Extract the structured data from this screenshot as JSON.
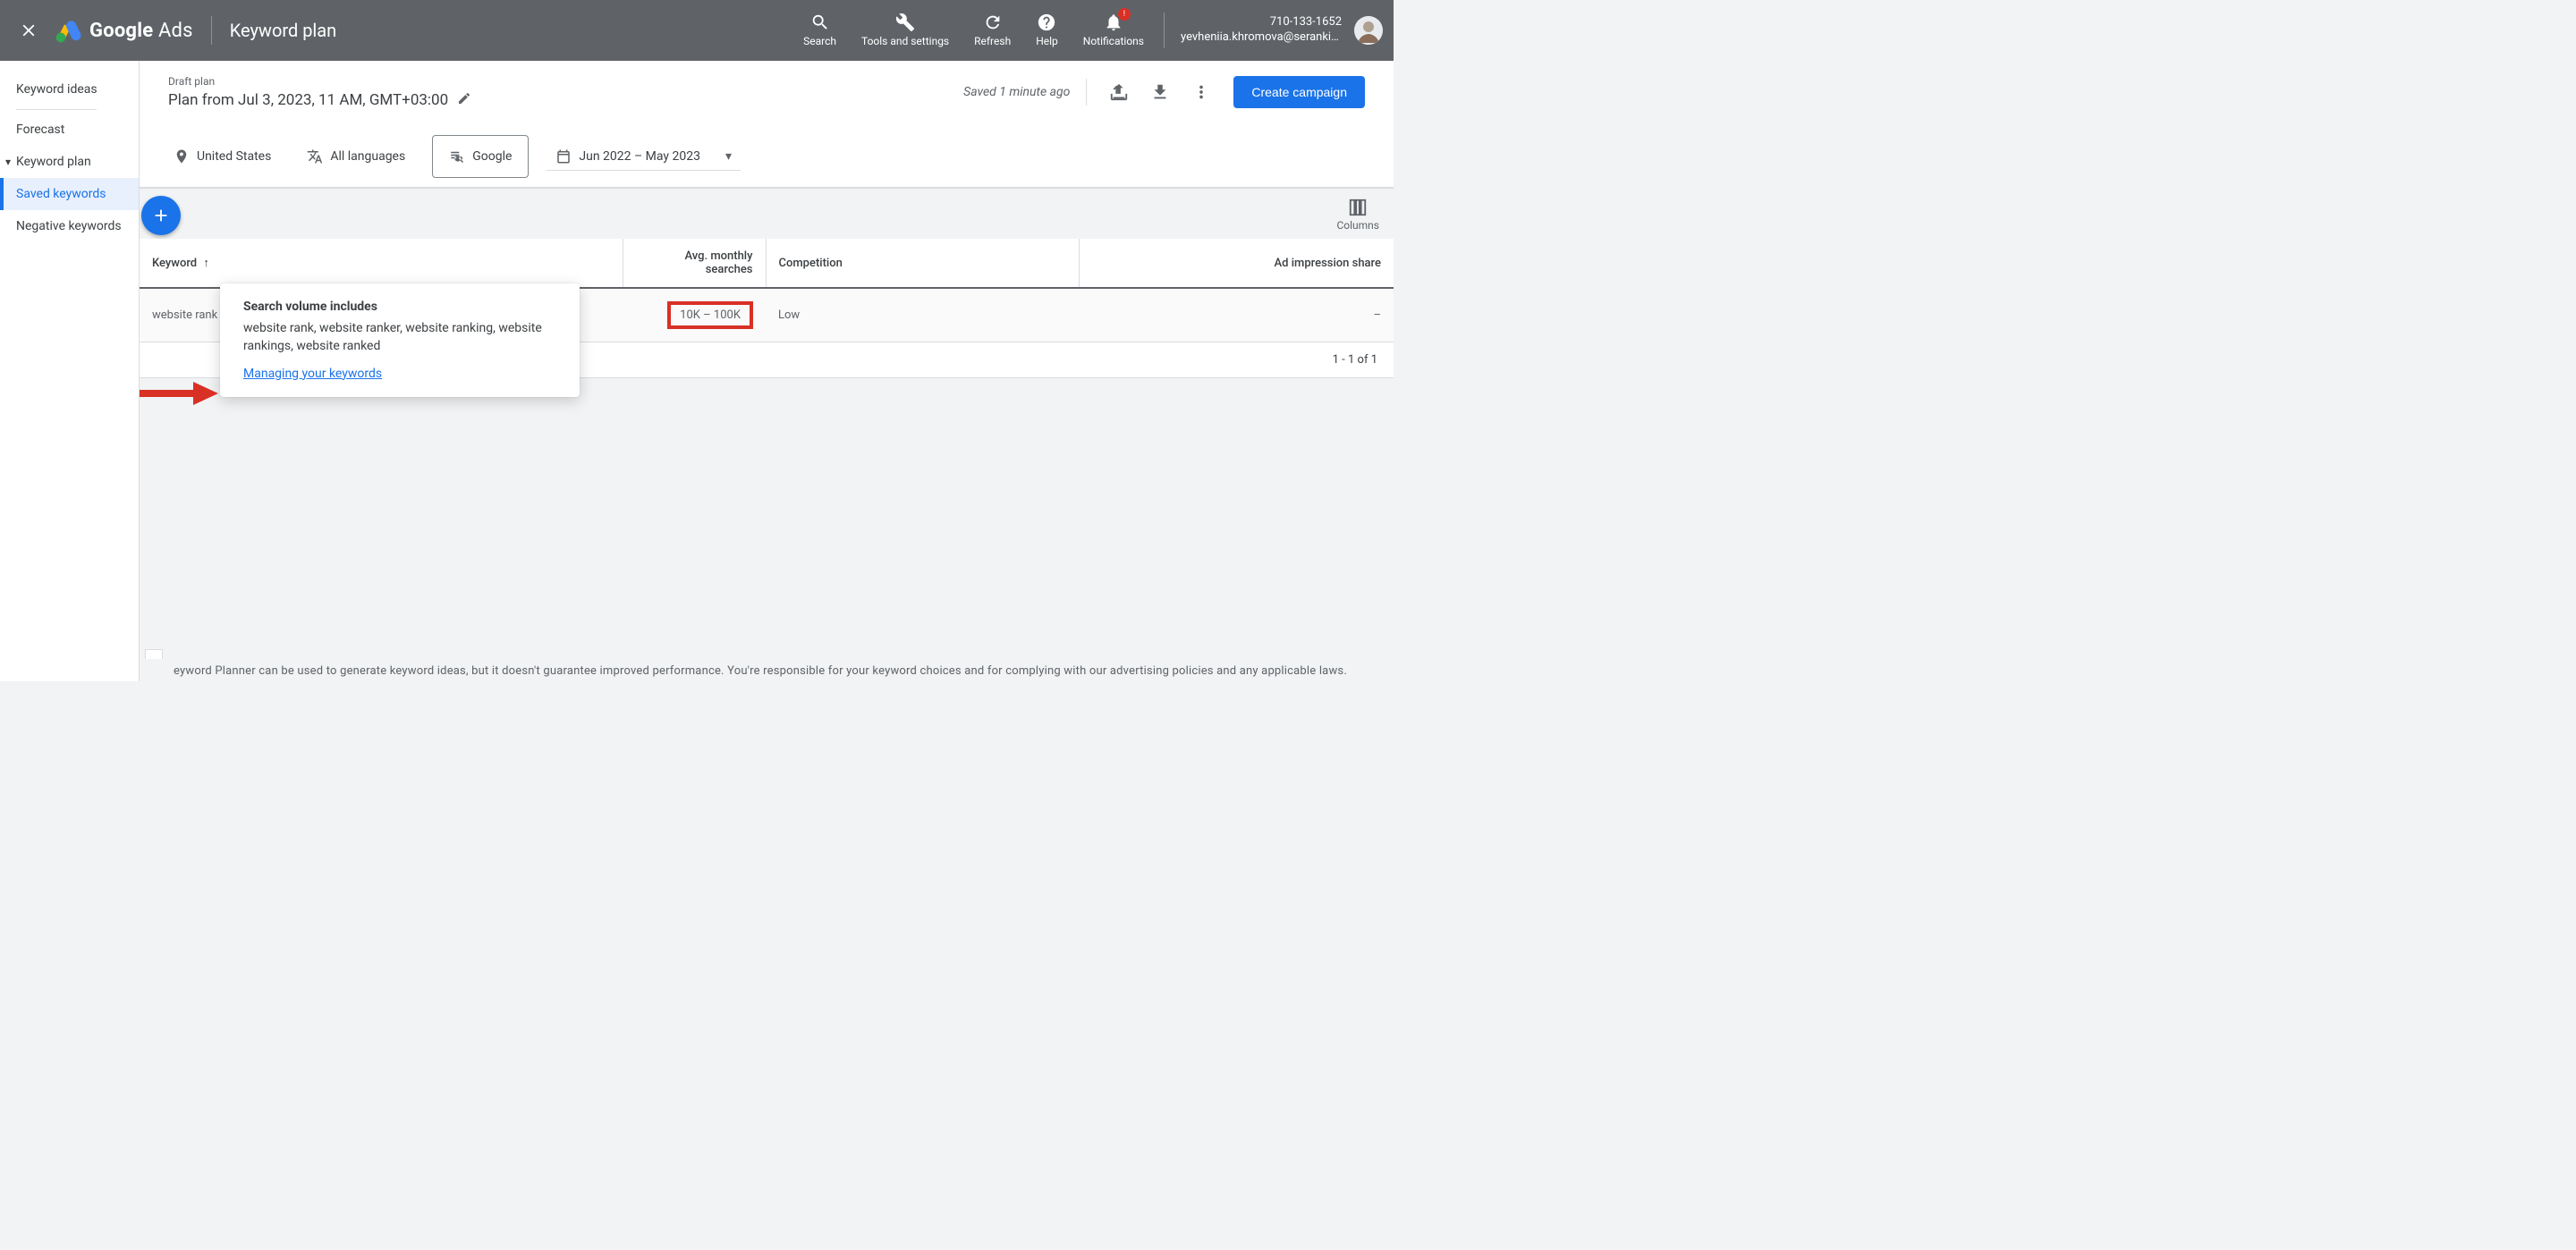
{
  "header": {
    "logo_text_html": "Google Ads",
    "page_title": "Keyword plan",
    "actions": {
      "search": "Search",
      "tools": "Tools and settings",
      "refresh": "Refresh",
      "help": "Help",
      "notifications": "Notifications"
    },
    "account_id": "710-133-1652",
    "account_email": "yevheniia.khromova@serankin…"
  },
  "sidebar": {
    "keyword_ideas": "Keyword ideas",
    "forecast": "Forecast",
    "keyword_plan": "Keyword plan",
    "saved_keywords": "Saved keywords",
    "negative_keywords": "Negative keywords"
  },
  "plan": {
    "draft_label": "Draft plan",
    "name": "Plan from Jul 3, 2023, 11 AM, GMT+03:00",
    "saved_status": "Saved 1 minute ago",
    "create_campaign": "Create campaign"
  },
  "filters": {
    "location": "United States",
    "language": "All languages",
    "network": "Google",
    "date_range": "Jun 2022 – May 2023"
  },
  "columns_label": "Columns",
  "popover": {
    "title": "Search volume includes",
    "body": "website rank, website ranker, website ranking, website rankings, website ranked",
    "link": "Managing your keywords"
  },
  "table": {
    "headers": {
      "keyword": "Keyword",
      "avg_searches": "Avg. monthly searches",
      "competition": "Competition",
      "ad_impression_share": "Ad impression share"
    },
    "rows": [
      {
        "keyword": "website rank",
        "avg_searches": "10K – 100K",
        "competition": "Low",
        "ad_impression_share": "–"
      }
    ]
  },
  "pagination": "1 - 1 of 1",
  "footer_disclaimer": "eyword Planner can be used to generate keyword ideas, but it doesn't guarantee improved performance. You're responsible for your keyword choices and for complying with our advertising policies and any applicable laws."
}
